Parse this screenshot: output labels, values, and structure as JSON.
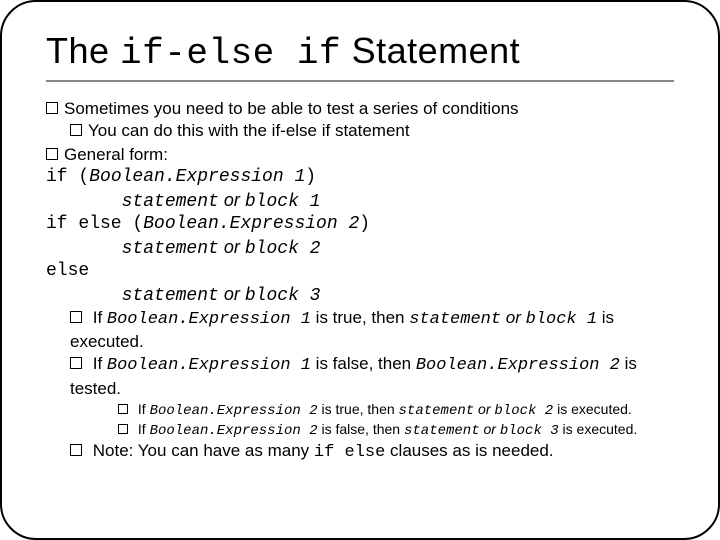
{
  "title": {
    "pre": "The ",
    "code": "if-else if",
    "post": " Statement"
  },
  "b1": "Sometimes you need to be able to test a series of conditions",
  "b1a": "You can do this with the if-else if statement",
  "b2": "General form:",
  "code": {
    "l1a": "if (",
    "l1b": "Boolean.Expression 1",
    "l1c": ")",
    "l2a": "       ",
    "l2b": "statement",
    "l2or": " or ",
    "l2c": "block 1",
    "l3a": "if else (",
    "l3b": "Boolean.Expression 2",
    "l3c": ")",
    "l4a": "       ",
    "l4b": "statement",
    "l4or": " or ",
    "l4c": "block 2",
    "l5": "else",
    "l6a": "       ",
    "l6b": "statement",
    "l6or": " or ",
    "l6c": "block 3"
  },
  "b3": {
    "t1": "If ",
    "expr": "Boolean.Expression 1",
    "t2": " is true, then ",
    "stmt": "statement",
    "or": " or ",
    "blk": "block 1",
    "t3": " is executed."
  },
  "b4": {
    "t1": "If ",
    "expr": "Boolean.Expression 1",
    "t2": " is false, then ",
    "expr2": "Boolean.Expression 2",
    "t3": " is tested."
  },
  "b4a": {
    "t1": "If ",
    "expr": "Boolean.Expression 2",
    "t2": " is true, then ",
    "stmt": "statement",
    "or": " or ",
    "blk": "block 2",
    "t3": " is executed."
  },
  "b4b": {
    "t1": "If ",
    "expr": "Boolean.Expression 2",
    "t2": " is false, then ",
    "stmt": "statement",
    "or": " or ",
    "blk": "block 3",
    "t3": " is executed."
  },
  "b5": {
    "t1": "Note:  You can have as many ",
    "code": "if else",
    "t2": " clauses as is needed."
  }
}
